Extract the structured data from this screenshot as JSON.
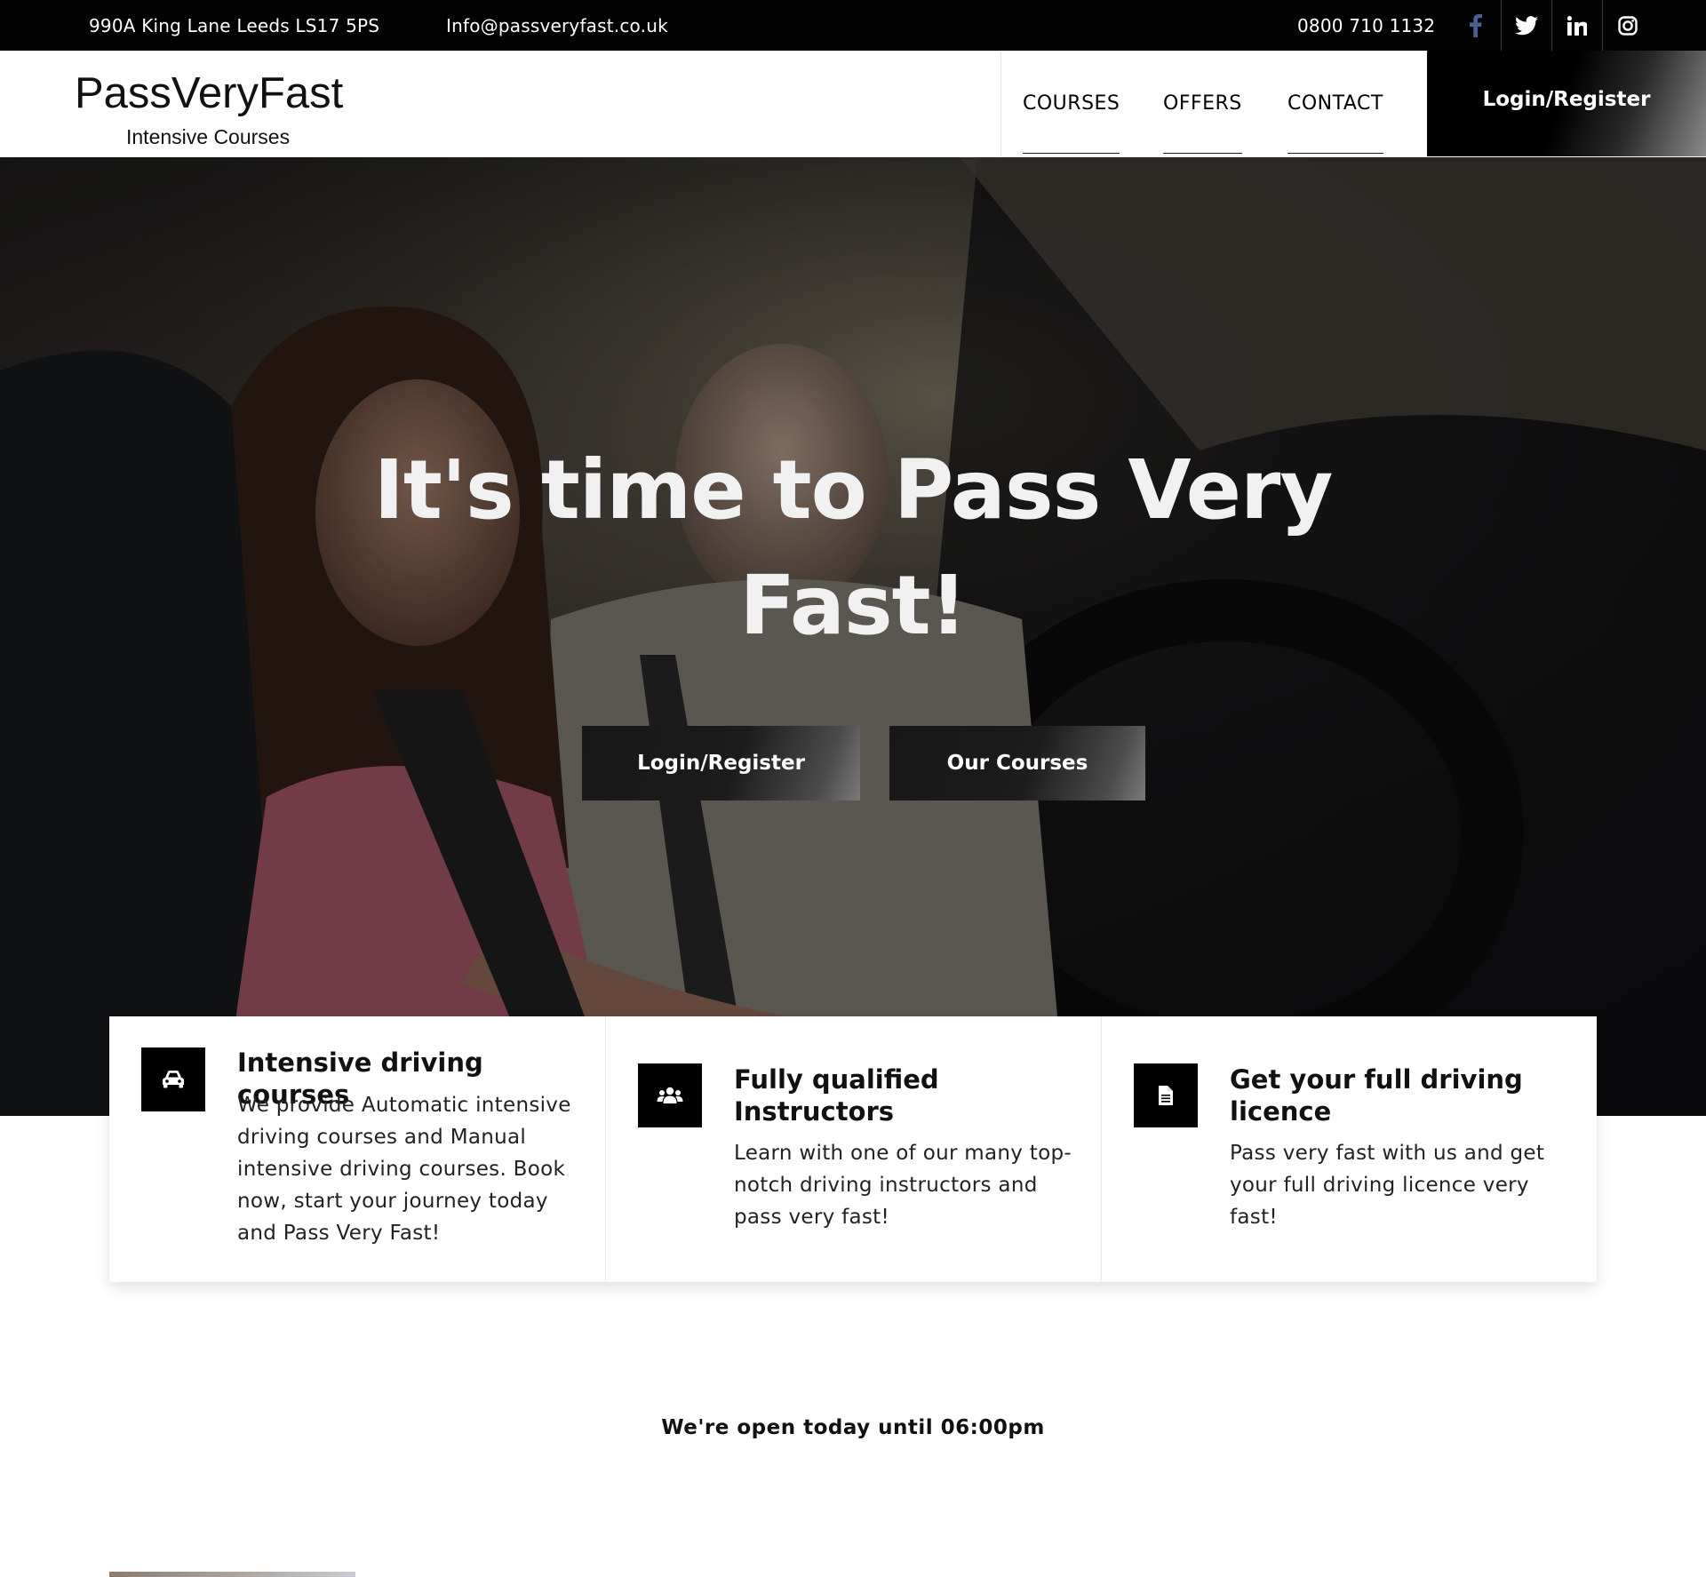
{
  "topbar": {
    "address": "990A King Lane Leeds LS17 5PS",
    "email": "Info@passveryfast.co.uk",
    "phone": "0800 710 1132",
    "social": [
      {
        "icon": "facebook-icon",
        "color": "#4a5f9a"
      },
      {
        "icon": "twitter-icon",
        "color": "#ffffff"
      },
      {
        "icon": "linkedin-icon",
        "color": "#ffffff"
      },
      {
        "icon": "instagram-icon",
        "color": "#ffffff"
      }
    ]
  },
  "header": {
    "logo_name": "PassVeryFast",
    "logo_tagline": "Intensive Courses",
    "nav": [
      "COURSES",
      "OFFERS",
      "CONTACT"
    ],
    "login_label": "Login/Register"
  },
  "hero": {
    "title": "It's time to Pass Very Fast!",
    "login_label": "Login/Register",
    "courses_label": "Our Courses"
  },
  "features": [
    {
      "icon": "car-icon",
      "title": "Intensive driving courses",
      "text": "We provide Automatic intensive driving courses and Manual intensive driving courses. Book now, start your journey today and Pass Very Fast!"
    },
    {
      "icon": "users-icon",
      "title": "Fully qualified Instructors",
      "text": "Learn with one of our many top-notch driving instructors and pass very fast!"
    },
    {
      "icon": "document-icon",
      "title": "Get your full driving licence",
      "text": "Pass very fast with us and get your full driving licence very fast!"
    }
  ],
  "status": {
    "open_text": "We're open today until 06:00pm"
  },
  "colors": {
    "topbar_bg": "#020202",
    "accent": "#000000",
    "text": "#111111"
  }
}
